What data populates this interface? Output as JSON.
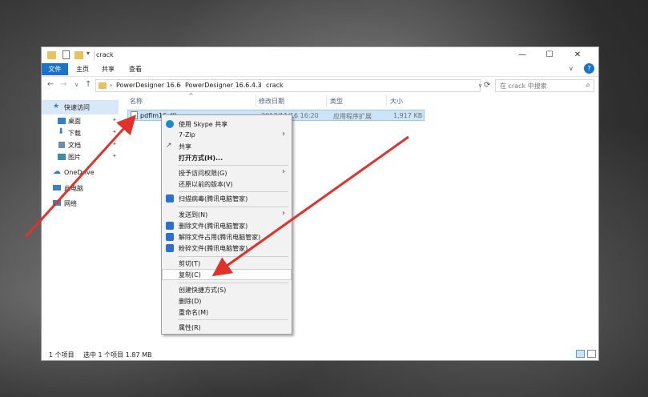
{
  "window": {
    "title": "crack",
    "buttons": {
      "minimize": "—",
      "maximize": "☐",
      "close": "✕"
    }
  },
  "ribbon": {
    "tabs": [
      "文件",
      "主页",
      "共享",
      "查看"
    ],
    "expand": "∨",
    "help": "?"
  },
  "address": {
    "crumbs": [
      "PowerDesigner 16.6",
      "PowerDesigner 16.6.4.3",
      "crack"
    ],
    "sep": "›",
    "dropdown": "∨",
    "refresh": "⟳"
  },
  "search": {
    "placeholder": "在 crack 中搜索",
    "icon": "⌕"
  },
  "nav": {
    "back": "←",
    "forward": "→",
    "recent": "∨",
    "up": "↑"
  },
  "sidebar": {
    "items": [
      {
        "label": "快速访问",
        "icon": "star-icon",
        "color": "#2f7fd1"
      },
      {
        "label": "桌面",
        "icon": "desktop-icon",
        "color": "#2f7fd1",
        "pinned": true
      },
      {
        "label": "下载",
        "icon": "download-icon",
        "color": "#2f7fd1",
        "pinned": true
      },
      {
        "label": "文档",
        "icon": "document-icon",
        "color": "#6d8bb0",
        "pinned": true
      },
      {
        "label": "图片",
        "icon": "picture-icon",
        "color": "#3e8e9f",
        "pinned": true
      },
      {
        "label": "OneDrive",
        "icon": "cloud-icon",
        "color": "#2f7fd1"
      },
      {
        "label": "此电脑",
        "icon": "computer-icon",
        "color": "#3d7fc0"
      },
      {
        "label": "网络",
        "icon": "network-icon",
        "color": "#3d7fc0"
      }
    ],
    "pin_glyph": "📌"
  },
  "columns": {
    "name": "名称",
    "modified": "修改日期",
    "type": "类型",
    "size": "大小",
    "sort": "^"
  },
  "file": {
    "name": "pdflm16.dll",
    "modified": "2017/11/16 16:20",
    "type": "应用程序扩展",
    "size": "1,917 KB"
  },
  "status": {
    "count": "1 个项目",
    "selected": "选中 1 个项目  1.87 MB"
  },
  "context_menu": {
    "items": [
      {
        "label": "使用 Skype 共享",
        "icon": "skype-icon",
        "color": "#1a8ad8"
      },
      {
        "label": "7-Zip",
        "submenu": true
      },
      {
        "label": "共享",
        "icon": "share-icon",
        "color": "#555555"
      },
      {
        "label": "打开方式(H)...",
        "bold": true
      },
      {
        "label": "授予访问权限(G)",
        "submenu": true
      },
      {
        "label": "还原以前的版本(V)"
      },
      {
        "label": "扫描病毒(腾讯电脑管家)",
        "icon": "shield-icon",
        "color": "#2a6fd6"
      },
      {
        "label": "发送到(N)",
        "submenu": true
      },
      {
        "label": "删除文件(腾讯电脑管家)",
        "icon": "delete-file-icon",
        "color": "#2a6fd6"
      },
      {
        "label": "解除文件占用(腾讯电脑管家)",
        "icon": "unlock-file-icon",
        "color": "#2a6fd6"
      },
      {
        "label": "粉碎文件(腾讯电脑管家)",
        "icon": "shred-file-icon",
        "color": "#2a6fd6"
      },
      {
        "label": "剪切(T)"
      },
      {
        "label": "复制(C)",
        "hover": true
      },
      {
        "label": "创建快捷方式(S)"
      },
      {
        "label": "删除(D)"
      },
      {
        "label": "重命名(M)"
      },
      {
        "label": "属性(R)"
      }
    ],
    "submenu_glyph": "›"
  },
  "annotation": {
    "arrow_color": "#e0322a"
  }
}
